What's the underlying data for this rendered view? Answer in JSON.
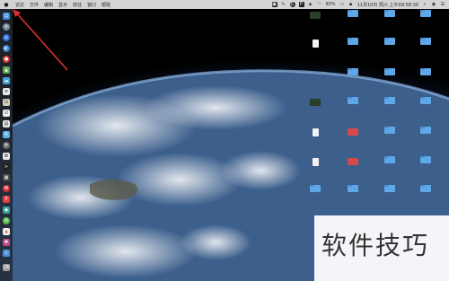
{
  "menubar": {
    "apple": "",
    "items": [
      "访达",
      "文件",
      "编辑",
      "显示",
      "前往",
      "窗口",
      "帮助"
    ],
    "status": {
      "clock": "11月10日 周六 上午09:58:30",
      "battery": "93%",
      "user": "天色渐晚",
      "c_icon": "C",
      "p_icon": "P"
    }
  },
  "watermark": "软件技巧",
  "colors": {
    "folder": "#5fa8e8",
    "menubar": "#e6e6e6",
    "arrow": "#e03030"
  }
}
